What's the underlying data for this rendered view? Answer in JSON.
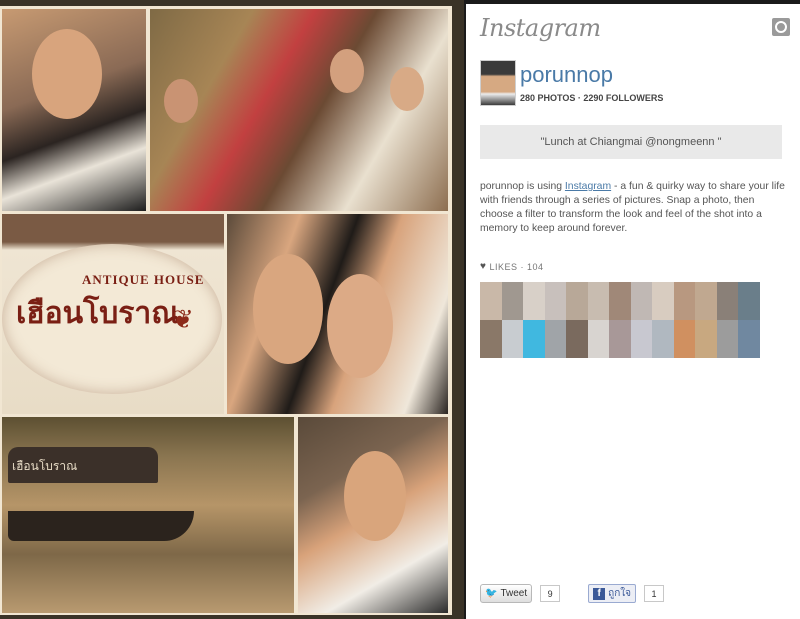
{
  "photo": {
    "sign_subtitle": "ANTIQUE HOUSE",
    "sign_thai": "เฮือนโบราณ",
    "boat_thai": "เฮือนโบราณ"
  },
  "instagram": {
    "logo": "Instagram",
    "username": "porunnop",
    "stats": "280 PHOTOS · 2290 FOLLOWERS",
    "caption": "\"Lunch at Chiangmai @nongmeenn \"",
    "desc_before": "porunnop is using ",
    "desc_link": "Instagram",
    "desc_after": " - a fun & quirky way to share your life with friends through a series of pictures. Snap a photo, then choose a filter to transform the look and feel of the shot into a memory to keep around forever.",
    "likes_label": "LIKES · 104",
    "tweet_label": "Tweet",
    "tweet_count": "9",
    "fb_label": "ถูกใจ",
    "fb_count": "1"
  },
  "colors": {
    "accent_link": "#4a7aa7",
    "facebook": "#3b5998",
    "twitter": "#3aa0d8"
  },
  "liker_colors": [
    "#c9b8a8",
    "#a09890",
    "#d8d0c8",
    "#c8c0bc",
    "#b8a898",
    "#c8bcb0",
    "#a08878",
    "#c0b8b4",
    "#d8ccc0",
    "#b89880",
    "#c0a890",
    "#8a8078",
    "#6a7e8a",
    "#8a7868",
    "#c8ccd0",
    "#40b8e0",
    "#a0a4a8",
    "#7a6a5e",
    "#d8d4d0",
    "#a89898",
    "#c8c8d0",
    "#b0b8c0",
    "#d09060",
    "#c8a880",
    "#9c9c9c",
    "#7088a0"
  ]
}
